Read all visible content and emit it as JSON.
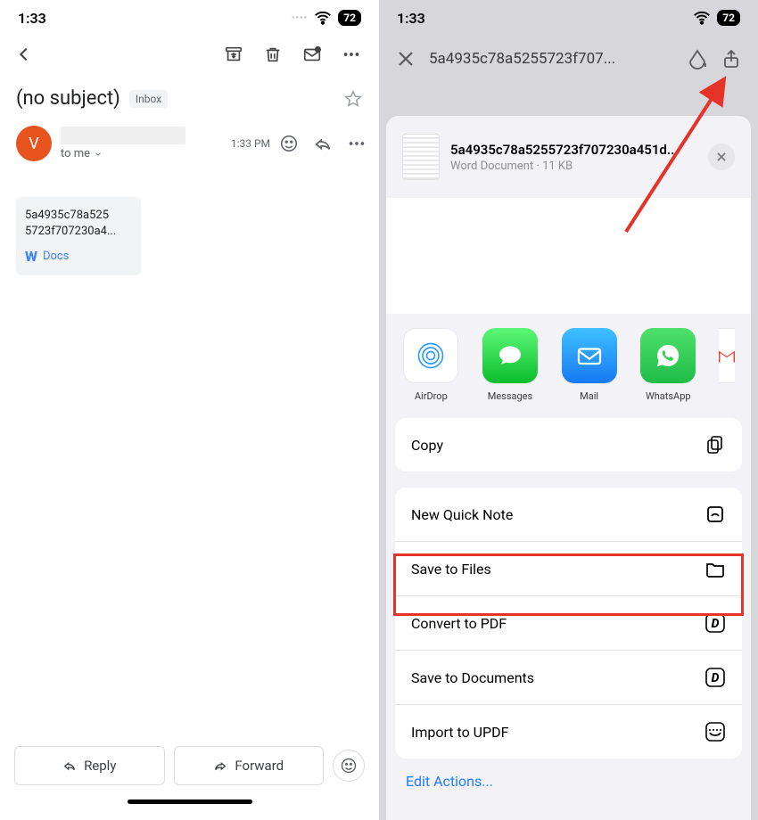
{
  "status": {
    "time": "1:33",
    "battery": "72"
  },
  "gmail": {
    "subject": "(no subject)",
    "badge": "Inbox",
    "avatar_initial": "V",
    "to_line": "to me",
    "time": "1:33 PM",
    "attachment": {
      "filename": "5a4935c78a5255723f707230a4...",
      "filename_wrapped_l1": "5a4935c78a525",
      "filename_wrapped_l2": "5723f707230a4...",
      "type_label": "Docs"
    },
    "reply_label": "Reply",
    "forward_label": "Forward"
  },
  "preview": {
    "title_truncated": "5a4935c78a5255723f707..."
  },
  "share": {
    "doc_name": "5a4935c78a5255723f707230a451d...",
    "doc_kind": "Word Document",
    "doc_size": "11 KB",
    "apps": [
      {
        "label": "AirDrop"
      },
      {
        "label": "Messages"
      },
      {
        "label": "Mail"
      },
      {
        "label": "WhatsApp"
      }
    ],
    "copy_label": "Copy",
    "actions": [
      {
        "label": "New Quick Note",
        "icon": "quicknote"
      },
      {
        "label": "Save to Files",
        "icon": "folder"
      },
      {
        "label": "Convert to PDF",
        "icon": "app-d"
      },
      {
        "label": "Save to Documents",
        "icon": "app-d"
      },
      {
        "label": "Import to UPDF",
        "icon": "updf"
      }
    ],
    "edit_actions": "Edit Actions..."
  },
  "annotation": {
    "highlight_index": 1
  }
}
